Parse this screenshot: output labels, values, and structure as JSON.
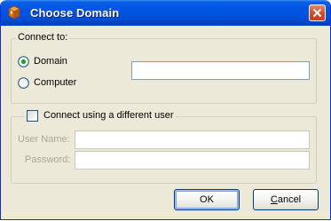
{
  "window": {
    "title": "Choose Domain",
    "icon": "package-icon",
    "close_label": "close-icon"
  },
  "connect_to": {
    "label": "Connect to:",
    "options": [
      {
        "label": "Domain",
        "selected": true
      },
      {
        "label": "Computer",
        "selected": false
      }
    ],
    "domain_value": ""
  },
  "credentials": {
    "checkbox_label": "Connect using a different user",
    "checked": false,
    "user_name_label": "User Name:",
    "user_name_value": "",
    "password_label": "Password:",
    "password_value": ""
  },
  "buttons": {
    "ok": "OK",
    "cancel_prefix": "C",
    "cancel_rest": "ancel"
  },
  "colors": {
    "titlebar": "#0054e3",
    "window_bg": "#ece9d8",
    "radio_dot": "#21a121"
  }
}
